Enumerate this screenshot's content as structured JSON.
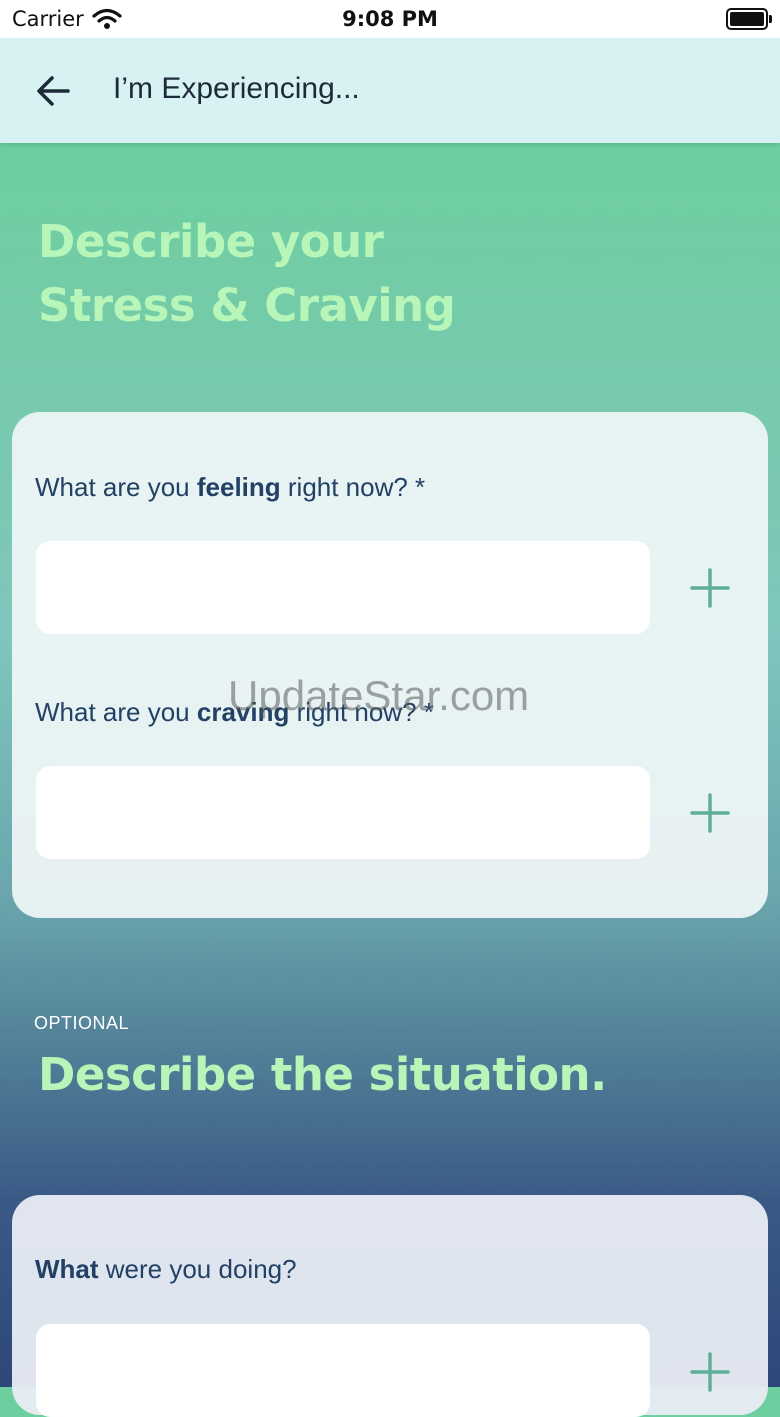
{
  "status_bar": {
    "carrier": "Carrier",
    "time": "9:08 PM"
  },
  "app_bar": {
    "title": "I’m Experiencing..."
  },
  "headline": {
    "line1": "Describe your",
    "line2": "Stress & Craving"
  },
  "card1": {
    "q1": {
      "pre": "What are you ",
      "bold": "feeling",
      "post": " right now? *"
    },
    "q2": {
      "pre": "What are you ",
      "bold": "craving",
      "post": " right now? *"
    },
    "field1_value": "",
    "field2_value": ""
  },
  "optional": {
    "label": "OPTIONAL",
    "title": "Describe the situation."
  },
  "card2": {
    "q3": {
      "bold": "What",
      "post": " were you doing?"
    },
    "field3_value": ""
  },
  "watermark": "UpdateStar.com",
  "colors": {
    "accent_green": "#b8f5b8",
    "text_navy": "#234065",
    "plus_teal": "#5fae97",
    "appbar_bg": "#d8f1f2"
  }
}
